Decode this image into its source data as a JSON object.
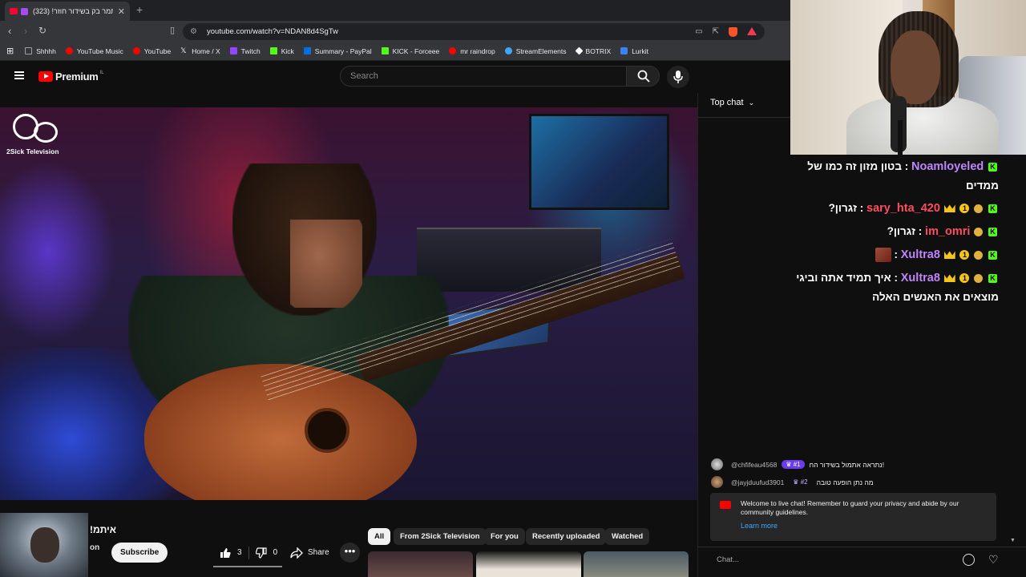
{
  "browser": {
    "tab_title": "איתמר בק בשידור חוזר! (323)",
    "new_tab": "+",
    "url": "youtube.com/watch?v=NDAN8d4SgTw",
    "bookmarks": [
      {
        "label": "Shhhh",
        "color": "#9aa0a6"
      },
      {
        "label": "YouTube Music",
        "color": "#ff0000"
      },
      {
        "label": "YouTube",
        "color": "#ff0000"
      },
      {
        "label": "Home / X",
        "color": "#ffffff"
      },
      {
        "label": "Twitch",
        "color": "#9146ff"
      },
      {
        "label": "Kick",
        "color": "#53fc18"
      },
      {
        "label": "Summary - PayPal",
        "color": "#0070e0"
      },
      {
        "label": "KICK - Forceee",
        "color": "#53fc18"
      },
      {
        "label": "mr raindrop",
        "color": "#ff0000"
      },
      {
        "label": "StreamElements",
        "color": "#3ea6ff"
      },
      {
        "label": "BOTRIX",
        "color": "#ffffff"
      },
      {
        "label": "Lurkit",
        "color": "#3b82f6"
      }
    ]
  },
  "youtube": {
    "logo_word": "Premium",
    "logo_region": "IL",
    "search_placeholder": "Search",
    "video_overlay_brand": "2Sick Television",
    "video_title": "!איתמ",
    "channel_sub": "on",
    "subscribe_label": "Subscribe",
    "likes": "3",
    "dislikes": "0",
    "share_label": "Share",
    "more_label": "•••",
    "chips": [
      "All",
      "From 2Sick Television",
      "For you",
      "Recently uploaded",
      "Watched"
    ]
  },
  "chat": {
    "header": "Top chat",
    "messages": [
      {
        "user": "Noamloyeled",
        "user_color": "#c084fc",
        "text": "בטון מזון זה כמו של ממדים"
      },
      {
        "user": "sary_hta_420",
        "user_color": "#ff4d5e",
        "text": "זגרון?"
      },
      {
        "user": "im_omri",
        "user_color": "#ff4d5e",
        "text": "זגרון?"
      },
      {
        "user": "Xultra8",
        "user_color": "#c084fc",
        "text": ""
      },
      {
        "user": "Xultra8",
        "user_color": "#c084fc",
        "text": "איך תמיד אתה וביגי מוצאים את האנשים האלה"
      }
    ],
    "top_donors": [
      {
        "handle": "@chfifeau4568",
        "rank": "#1",
        "text": "נתראה אתמול בשידור הח!"
      },
      {
        "handle": "@jayjduufud3901",
        "rank": "#2",
        "text": "מה נתן הופעה טובה"
      }
    ],
    "welcome_text": "Welcome to live chat! Remember to guard your privacy and abide by our community guidelines.",
    "learn_more": "Learn more",
    "input_placeholder": "Chat..."
  }
}
